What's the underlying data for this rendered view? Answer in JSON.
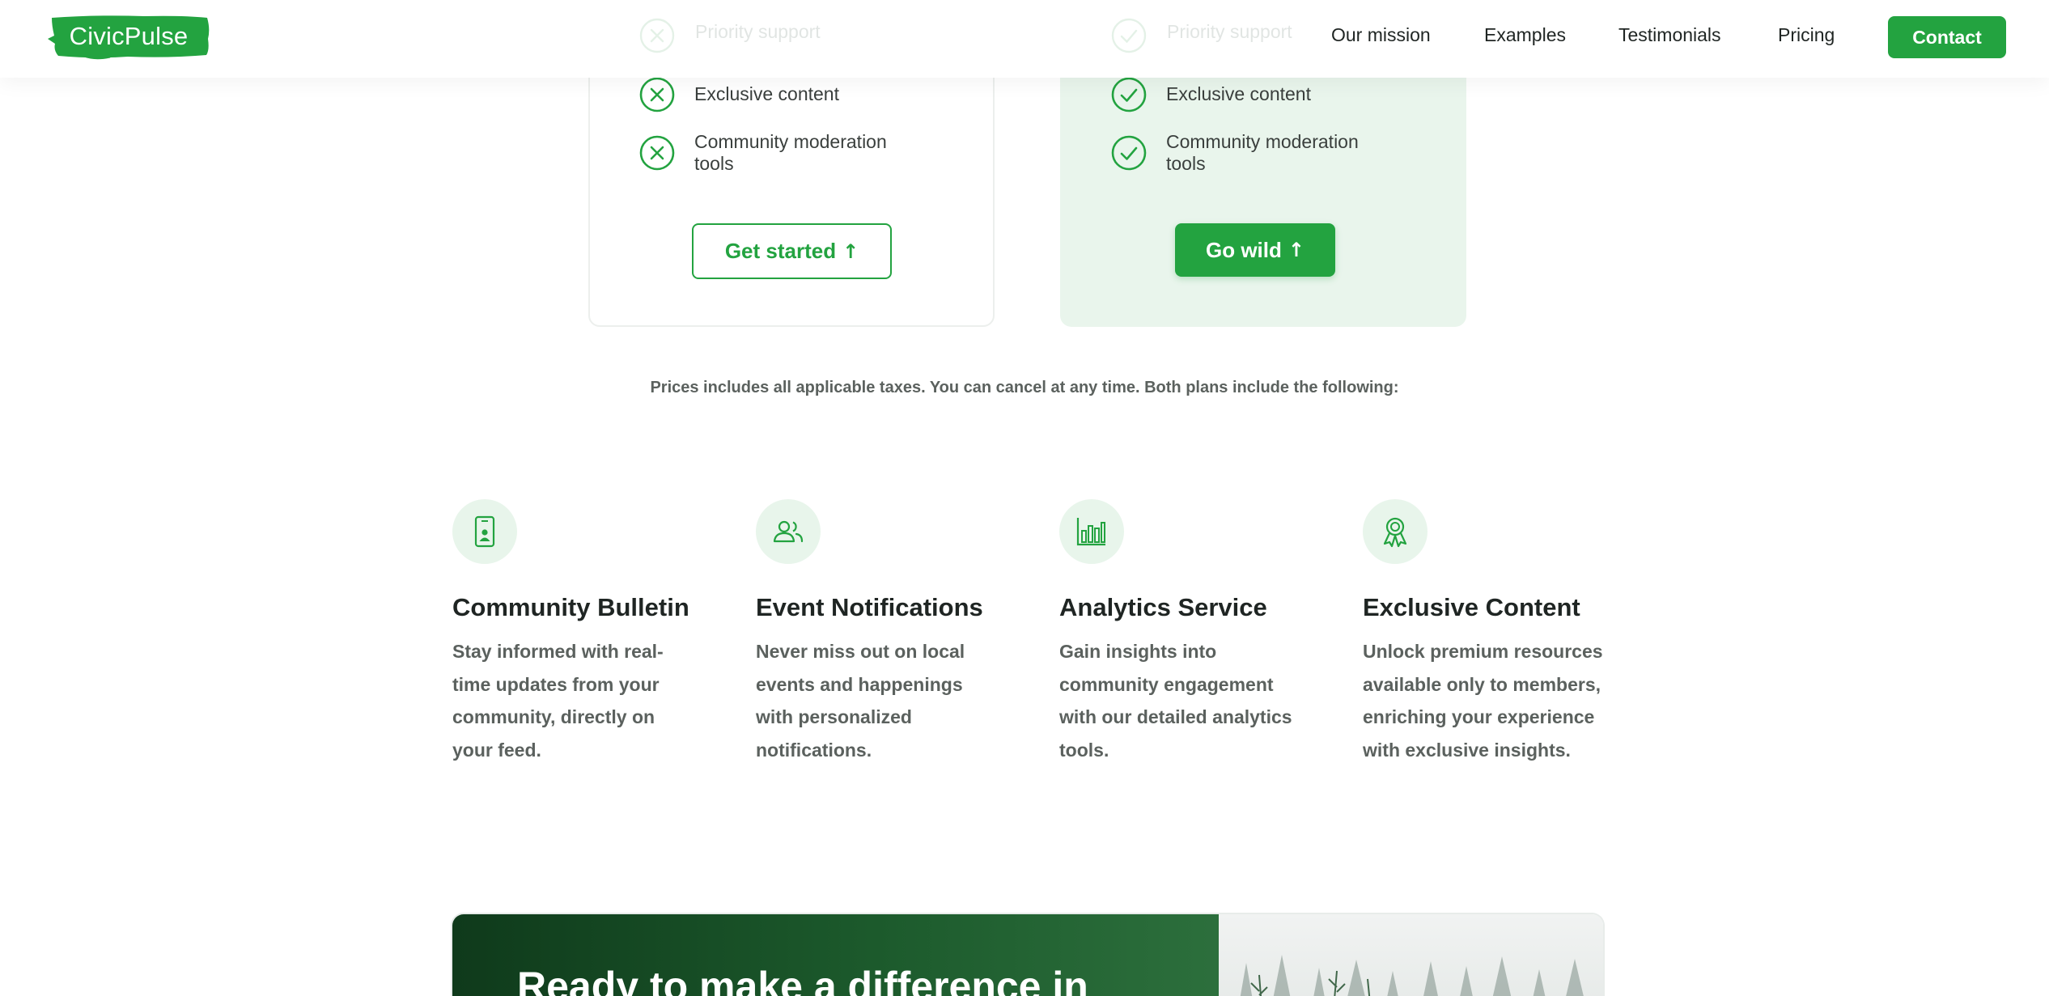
{
  "brand": {
    "name": "CivicPulse",
    "accent": "#23a340"
  },
  "nav": {
    "items": [
      "Our mission",
      "Examples",
      "Testimonials",
      "Pricing"
    ],
    "contact_label": "Contact"
  },
  "pricing": {
    "basic": {
      "features": [
        {
          "label": "Priority support",
          "icon": "x-circle-icon"
        },
        {
          "label": "Exclusive content",
          "icon": "x-circle-icon"
        },
        {
          "label": "Community moderation tools",
          "icon": "x-circle-icon"
        }
      ],
      "cta_label": "Get started",
      "cta_icon": "arrow-up-icon"
    },
    "pro": {
      "features": [
        {
          "label": "Priority support",
          "icon": "check-circle-icon"
        },
        {
          "label": "Exclusive content",
          "icon": "check-circle-icon"
        },
        {
          "label": "Community moderation tools",
          "icon": "check-circle-icon"
        }
      ],
      "cta_label": "Go wild",
      "cta_icon": "arrow-up-icon"
    },
    "note": "Prices includes all applicable taxes. You can cancel at any time. Both plans include the following:"
  },
  "features": [
    {
      "icon": "mobile-user-icon",
      "title": "Community Bulletin",
      "desc": "Stay informed with real-time updates from your community, directly on your feed."
    },
    {
      "icon": "users-icon",
      "title": "Event Notifications",
      "desc": "Never miss out on local events and happenings with personalized notifications."
    },
    {
      "icon": "bar-chart-icon",
      "title": "Analytics Service",
      "desc": "Gain insights into community engagement with our detailed analytics tools."
    },
    {
      "icon": "award-icon",
      "title": "Exclusive Content",
      "desc": "Unlock premium resources available only to members, enriching your experience with exclusive insights."
    }
  ],
  "cta": {
    "title": "Ready to make a difference in"
  }
}
